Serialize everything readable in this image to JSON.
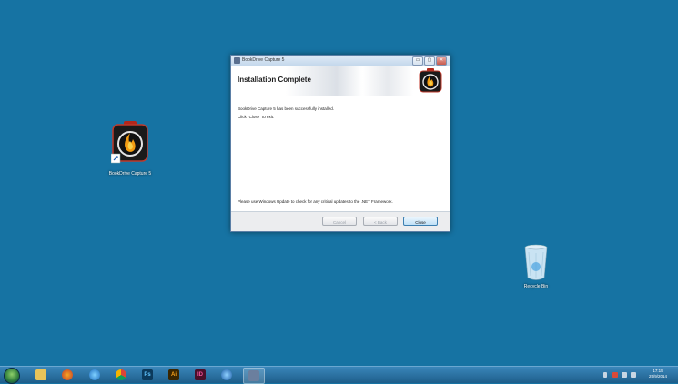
{
  "desktop": {
    "icons": [
      {
        "label": "BookDrive Capture 5"
      },
      {
        "label": "Recycle Bin"
      }
    ]
  },
  "dialog": {
    "window_title": "BookDrive Capture 5",
    "header_title": "Installation Complete",
    "message": "BookDrive Capture 5 has been successfully installed.",
    "instruction": "Click \"Close\" to exit.",
    "note": "Please use Windows Update to check for any critical updates to the .NET Framework.",
    "buttons": {
      "cancel": "Cancel",
      "back": "< Back",
      "close": "Close"
    },
    "window_controls": {
      "minimize": "▭",
      "maximize": "▢",
      "close": "✕"
    }
  },
  "taskbar": {
    "apps": [
      {
        "name": "start-orb"
      },
      {
        "name": "file-explorer-icon"
      },
      {
        "name": "firefox-icon"
      },
      {
        "name": "internet-explorer-icon"
      },
      {
        "name": "chrome-icon"
      },
      {
        "name": "photoshop-icon",
        "text": "Ps"
      },
      {
        "name": "illustrator-icon",
        "text": "Ai"
      },
      {
        "name": "indesign-icon",
        "text": "ID"
      },
      {
        "name": "media-player-icon"
      },
      {
        "name": "installer-icon"
      }
    ],
    "clock": {
      "time": "17:15",
      "date": "25/9/2014"
    }
  },
  "colors": {
    "desktop_bg": "#1673a3",
    "taskbar": "#2b73a6",
    "accent_button": "#3c7fb1"
  }
}
